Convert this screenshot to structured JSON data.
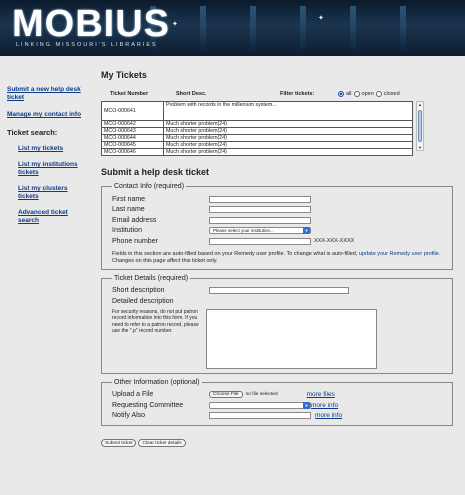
{
  "header": {
    "logo": "MOBIUS",
    "tagline": "LINKING MISSOURI'S LIBRARIES"
  },
  "sidebar": {
    "links": [
      {
        "label": "Submit a new help desk ticket"
      },
      {
        "label": "Manage my contact info"
      }
    ],
    "search_heading": "Ticket search:",
    "search_links": [
      {
        "label": "List my tickets"
      },
      {
        "label": "List my institutions tickets"
      },
      {
        "label": "List my clusters tickets"
      },
      {
        "label": "Advanced ticket search"
      }
    ]
  },
  "tickets": {
    "title": "My Tickets",
    "columns": {
      "number": "Ticket Number",
      "desc": "Short Desc."
    },
    "filter_label": "Filter tickets:",
    "filters": [
      {
        "label": "all",
        "checked": true
      },
      {
        "label": "open",
        "checked": false
      },
      {
        "label": "closed",
        "checked": false
      }
    ],
    "rows": [
      {
        "number": "MCO-000641",
        "desc": "Problem with records in the millenium system..."
      },
      {
        "number": "MCO-000642",
        "desc": "Much shorter problem(24)"
      },
      {
        "number": "MCO-000643",
        "desc": "Much shorter problem(24)"
      },
      {
        "number": "MCO-000644",
        "desc": "Much shorter problem(24)"
      },
      {
        "number": "MCO-000645",
        "desc": "Much shorter problem(24)"
      },
      {
        "number": "MCO-000646",
        "desc": "Much shorter problem(24)"
      }
    ]
  },
  "form": {
    "title": "Submit a help desk ticket",
    "contact": {
      "legend": "Contact Info (required)",
      "first_name": "First name",
      "last_name": "Last name",
      "email": "Email address",
      "institution": "Institution",
      "institution_placeholder": "Please select your institution...",
      "phone": "Phone number",
      "phone_format": "XXX-XXX-XXXX",
      "note_a": "Fields in this section are auto-filled based on your Remedy user profile. To change what is auto-filled,",
      "note_link": "update your Remedy user profile",
      "note_b": ". Changes on this page affect this ticket only."
    },
    "details": {
      "legend": "Ticket Details (required)",
      "short_desc": "Short description",
      "detailed_desc": "Detailed description",
      "security_note": "For security reasons, do not put patron record information into this form. If you need to refer to a patron record, please use the \".p\" record number."
    },
    "other": {
      "legend": "Other Information (optional)",
      "upload": "Upload a File",
      "choose_file": "Choose File",
      "no_file": "no file selected",
      "more_files": "more files",
      "committee": "Requesting Committee",
      "more_info_1": "more info",
      "notify": "Notify Also",
      "more_info_2": "more info"
    },
    "submit_label": "Submit ticket",
    "clear_label": "Clear ticket details"
  }
}
